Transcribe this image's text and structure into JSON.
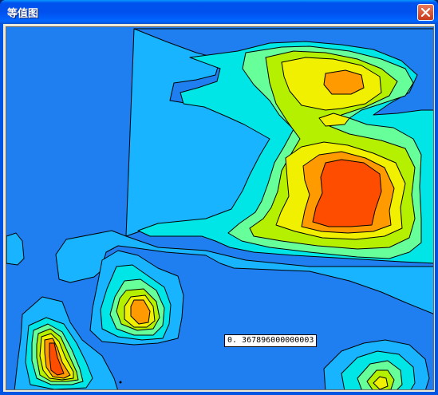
{
  "window": {
    "title": "等值图",
    "close_icon": "close-x-icon"
  },
  "contour_map": {
    "probe_value": "0. 367896000000003"
  },
  "colors": {
    "title_bar": "#0054e3",
    "level_1": "#1f7ff0",
    "level_2": "#18b4ff",
    "level_3": "#00e6e6",
    "level_4": "#66ff99",
    "level_5": "#b4f000",
    "level_6": "#f0f000",
    "level_7": "#ff9a00",
    "level_8": "#ff4d00"
  }
}
